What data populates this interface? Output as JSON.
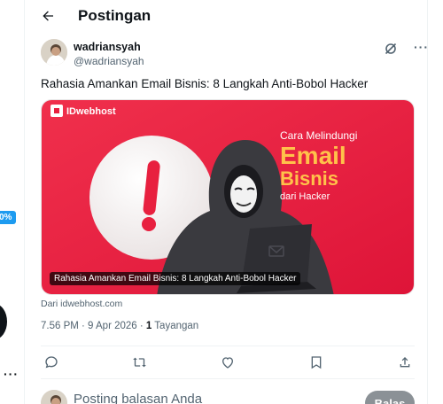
{
  "header": {
    "title": "Postingan"
  },
  "side": {
    "badge": "0%",
    "more": "···"
  },
  "post": {
    "author_name": "wadriansyah",
    "author_handle": "@wadriansyah",
    "text": "Rahasia Amankan Email Bisnis: 8 Langkah Anti-Bobol Hacker",
    "card": {
      "brand": "IDwebhost",
      "line1": "Cara Melindungi",
      "line2": "Email",
      "line3": "Bisnis",
      "line4": "dari Hacker",
      "caption": "Rahasia Amankan Email Bisnis: 8 Langkah Anti-Bobol Hacker"
    },
    "source": "Dari idwebhost.com",
    "timestamp": "7.56 PM · 9 Apr 2026 · ",
    "views_count": "1",
    "views_label": " Tayangan"
  },
  "reply": {
    "placeholder": "Posting balasan Anda",
    "button_label": "Balas"
  },
  "colors": {
    "accent": "#1d9bf0",
    "card_bg": "#e8203f",
    "muted": "#536471"
  },
  "icons": [
    "back-arrow-icon",
    "grok-icon",
    "more-icon",
    "reply-icon",
    "repost-icon",
    "like-icon",
    "bookmark-icon",
    "share-icon"
  ]
}
